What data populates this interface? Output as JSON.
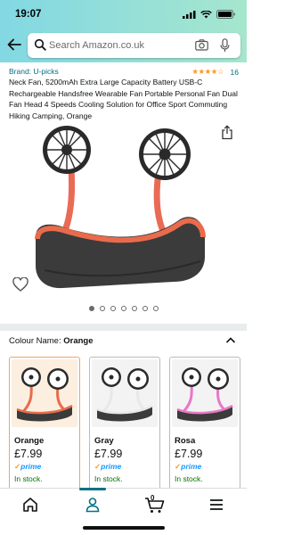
{
  "status_bar": {
    "time": "19:07"
  },
  "search": {
    "placeholder": "Search Amazon.co.uk"
  },
  "product": {
    "brand": "Brand: U-picks",
    "stars": "★★★★☆",
    "rating_count": "16",
    "title": "Neck Fan, 5200mAh Extra Large Capacity Battery USB-C Rechargeable Handsfree Wearable Fan Portable Personal Fan Dual Fan Head 4 Speeds Cooling Solution for Office Sport Commuting Hiking Camping, Orange",
    "image_count": 7,
    "active_image_index": 0
  },
  "variation": {
    "label": "Colour Name: ",
    "selected": "Orange",
    "options": [
      {
        "name": "Orange",
        "price": "£7.99",
        "prime": "prime",
        "stock": "In stock.",
        "band_color": "#e96b4c"
      },
      {
        "name": "Gray",
        "price": "£7.99",
        "prime": "prime",
        "stock": "In stock.",
        "band_color": "#e8e8e8"
      },
      {
        "name": "Rosa",
        "price": "£7.99",
        "prime": "prime",
        "stock": "In stock.",
        "band_color": "#e978c6"
      }
    ]
  },
  "bottom_nav": {
    "cart_count": "0"
  },
  "colors": {
    "link": "#007185",
    "star": "#f59b1f",
    "stock": "#007600",
    "prime": "#1a98ff"
  }
}
